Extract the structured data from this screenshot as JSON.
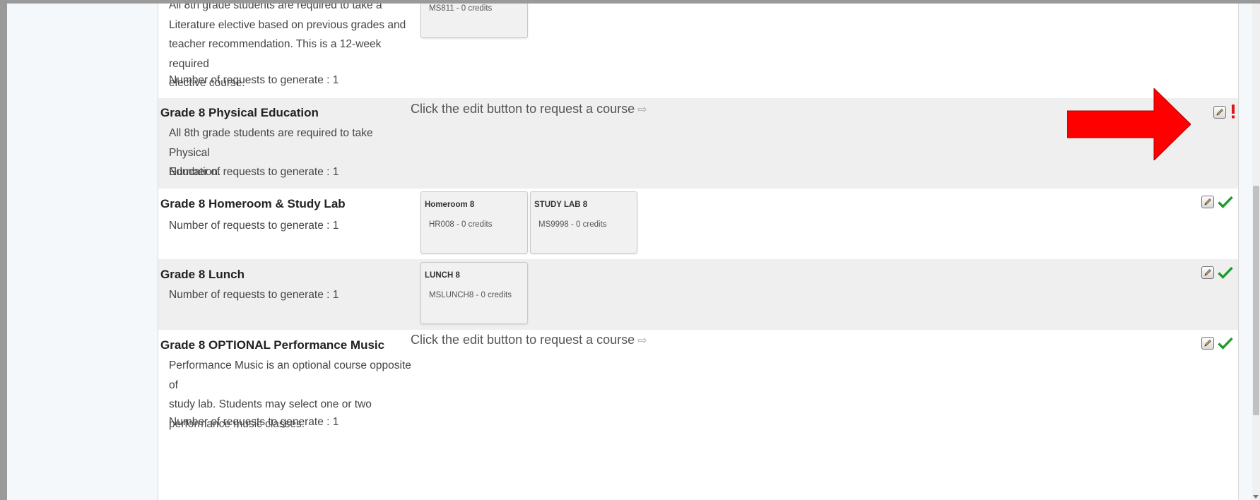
{
  "sections": [
    {
      "id": "literature",
      "description_lines": [
        "All 8th grade students are required to take a",
        "Literature elective based on previous grades and",
        "teacher recommendation. This is a 12-week required",
        "elective course."
      ],
      "requests": "Number of requests to generate : 1",
      "courses": [
        {
          "credits": "MS811 - 0 credits"
        }
      ]
    },
    {
      "id": "pe",
      "title": "Grade 8 Physical Education",
      "description_lines": [
        "All 8th grade students are required to take Physical",
        "Education."
      ],
      "requests": "Number of requests to generate : 1",
      "message": "Click the edit button to request a course",
      "status": "incomplete"
    },
    {
      "id": "homeroom",
      "title": "Grade 8 Homeroom & Study Lab",
      "requests": "Number of requests to generate : 1",
      "courses": [
        {
          "name": "Homeroom 8",
          "credits": "HR008 - 0 credits"
        },
        {
          "name": "STUDY LAB 8",
          "credits": "MS9998 - 0 credits"
        }
      ],
      "status": "complete"
    },
    {
      "id": "lunch",
      "title": "Grade 8 Lunch",
      "requests": "Number of requests to generate : 1",
      "courses": [
        {
          "name": "LUNCH 8",
          "credits": "MSLUNCH8 - 0 credits"
        }
      ],
      "status": "complete"
    },
    {
      "id": "music",
      "title": "Grade 8 OPTIONAL Performance Music",
      "description_lines": [
        "Performance Music is an optional course opposite of",
        "study lab. Students may select one or two",
        "performance music classes."
      ],
      "requests": "Number of requests to generate : 1",
      "message": "Click the edit button to request a course",
      "status": "complete"
    }
  ],
  "icons": {
    "edit": "pencil-edit-icon",
    "complete": "green-check-icon",
    "incomplete": "red-exclamation-icon",
    "hint_arrow": "right-arrow-icon",
    "annotation": "red-arrow-annotation"
  },
  "colors": {
    "check": "#1e9a2b",
    "exclamation": "#d9161c",
    "annotation_arrow": "#ff0000",
    "alt_row": "#efefef"
  }
}
